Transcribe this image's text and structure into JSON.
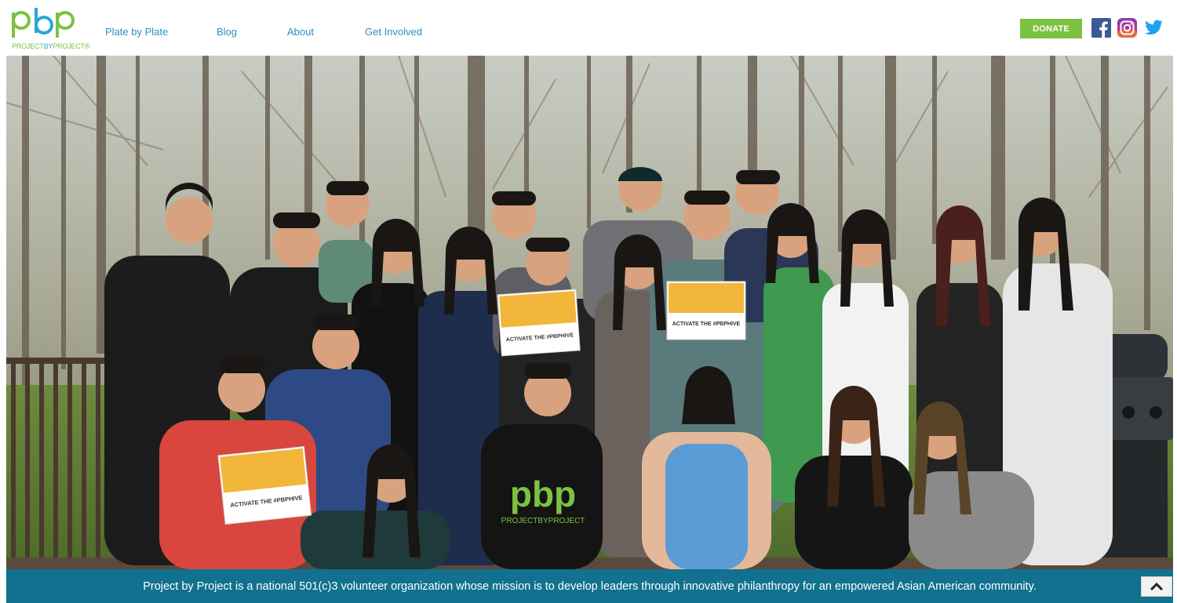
{
  "header": {
    "logo": {
      "mark": "pbp",
      "sub_left": "PROJECT",
      "sub_mid": "BY",
      "sub_right": "PROJECT",
      "sub_mark": "®"
    },
    "nav": [
      {
        "label": "Plate by Plate"
      },
      {
        "label": "Blog"
      },
      {
        "label": "About"
      },
      {
        "label": "Get Involved"
      }
    ],
    "donate_label": "DONATE",
    "social": [
      "facebook-icon",
      "instagram-icon",
      "twitter-icon"
    ]
  },
  "hero": {
    "signs": [
      {
        "headline": "ACTIVATE THE #PBPHIVE"
      },
      {
        "headline": "ACTIVATE THE #PBPHIVE"
      },
      {
        "headline": "ACTIVATE THE #PBPHIVE"
      }
    ],
    "shirt_logo": "pbp",
    "shirt_sub": "PROJECTBYPROJECT"
  },
  "mission": {
    "text": "Project by Project is a national 501(c)3 volunteer organization whose mission is to develop leaders through innovative philanthropy for an empowered Asian American community."
  },
  "colors": {
    "brand_green": "#7cc242",
    "brand_blue": "#2aa7d8",
    "nav_blue": "#2b8fc3",
    "mission_bar": "#11718f",
    "facebook": "#3b5998",
    "twitter": "#1da1f2"
  }
}
